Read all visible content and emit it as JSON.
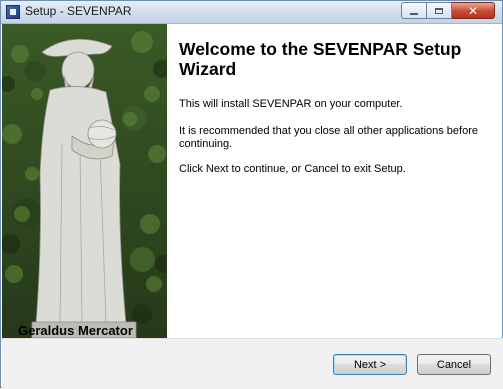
{
  "window": {
    "title": "Setup - SEVENPAR",
    "icon": "setup-app-icon"
  },
  "side_image": {
    "caption": "Geraldus Mercator",
    "subject": "statue-photo"
  },
  "content": {
    "heading": "Welcome to the SEVENPAR Setup Wizard",
    "paragraph1": "This will install SEVENPAR on your computer.",
    "paragraph2": "It is recommended that you close all other applications before continuing.",
    "paragraph3": "Click Next to continue, or Cancel to exit Setup."
  },
  "buttons": {
    "next_label": "Next >",
    "cancel_label": "Cancel"
  },
  "colors": {
    "title_bar": "#cfdceb",
    "close_button": "#c94a33",
    "footer": "#f0f0f0"
  }
}
